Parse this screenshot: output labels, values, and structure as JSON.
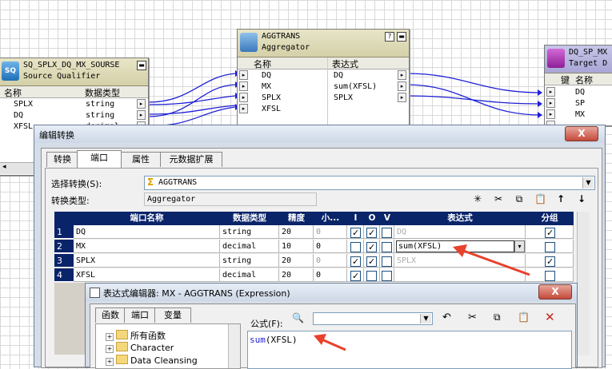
{
  "source_qualifier": {
    "title": "SQ_SPLX_DQ_MX_SOURSE",
    "subtitle": "Source Qualifier",
    "icon_label": "SQ",
    "col_name": "名称",
    "col_type": "数据类型",
    "rows": [
      {
        "name": "SPLX",
        "type": "string"
      },
      {
        "name": "DQ",
        "type": "string"
      },
      {
        "name": "XFSL",
        "type": "decimal"
      }
    ]
  },
  "aggregator": {
    "title": "AGGTRANS",
    "subtitle": "Aggregator",
    "col_name": "名称",
    "col_expr": "表达式",
    "help": "?",
    "rows": [
      {
        "name": "DQ",
        "expr": "DQ"
      },
      {
        "name": "MX",
        "expr": "sum(XFSL)"
      },
      {
        "name": "SPLX",
        "expr": "SPLX"
      },
      {
        "name": "XFSL",
        "expr": ""
      }
    ]
  },
  "target": {
    "title": "DQ_SP_MX",
    "subtitle": "Target D",
    "col_key": "键",
    "col_name": "名称",
    "rows": [
      {
        "name": "DQ"
      },
      {
        "name": "SP"
      },
      {
        "name": "MX"
      }
    ]
  },
  "edit_dialog": {
    "title": "编辑转换",
    "close": "X",
    "tabs": [
      {
        "label": "转换"
      },
      {
        "label": "端口"
      },
      {
        "label": "属性"
      },
      {
        "label": "元数据扩展"
      }
    ],
    "select_label": "选择转换(S):",
    "select_value": "AGGTRANS",
    "type_label": "转换类型:",
    "type_value": "Aggregator",
    "headers": [
      "端口名称",
      "数据类型",
      "精度",
      "小...",
      "I",
      "O",
      "V",
      "表达式",
      "分组"
    ],
    "rows": [
      {
        "num": "1",
        "name": "DQ",
        "type": "string",
        "prec": "20",
        "scale": "0",
        "i": true,
        "o": true,
        "v": false,
        "expr": "DQ",
        "group": true
      },
      {
        "num": "2",
        "name": "MX",
        "type": "decimal",
        "prec": "10",
        "scale": "0",
        "i": false,
        "o": true,
        "v": false,
        "expr": "sum(XFSL)",
        "group": false
      },
      {
        "num": "3",
        "name": "SPLX",
        "type": "string",
        "prec": "20",
        "scale": "0",
        "i": true,
        "o": true,
        "v": false,
        "expr": "SPLX",
        "group": true
      },
      {
        "num": "4",
        "name": "XFSL",
        "type": "decimal",
        "prec": "20",
        "scale": "0",
        "i": true,
        "o": false,
        "v": false,
        "expr": "",
        "group": false
      }
    ]
  },
  "expr_dialog": {
    "title": "表达式编辑器: MX - AGGTRANS (Expression)",
    "close": "X",
    "tabs": [
      {
        "label": "函数"
      },
      {
        "label": "端口"
      },
      {
        "label": "变量"
      }
    ],
    "tree": [
      {
        "label": "所有函数"
      },
      {
        "label": "Character"
      },
      {
        "label": "Data Cleansing"
      }
    ],
    "formula_label": "公式(F):",
    "formula_func": "sum",
    "formula_arg": "(XFSL)"
  },
  "colors": {
    "arrow": "#e8412c",
    "link": "#1f1fd6",
    "grid_header": "#0a246a"
  }
}
